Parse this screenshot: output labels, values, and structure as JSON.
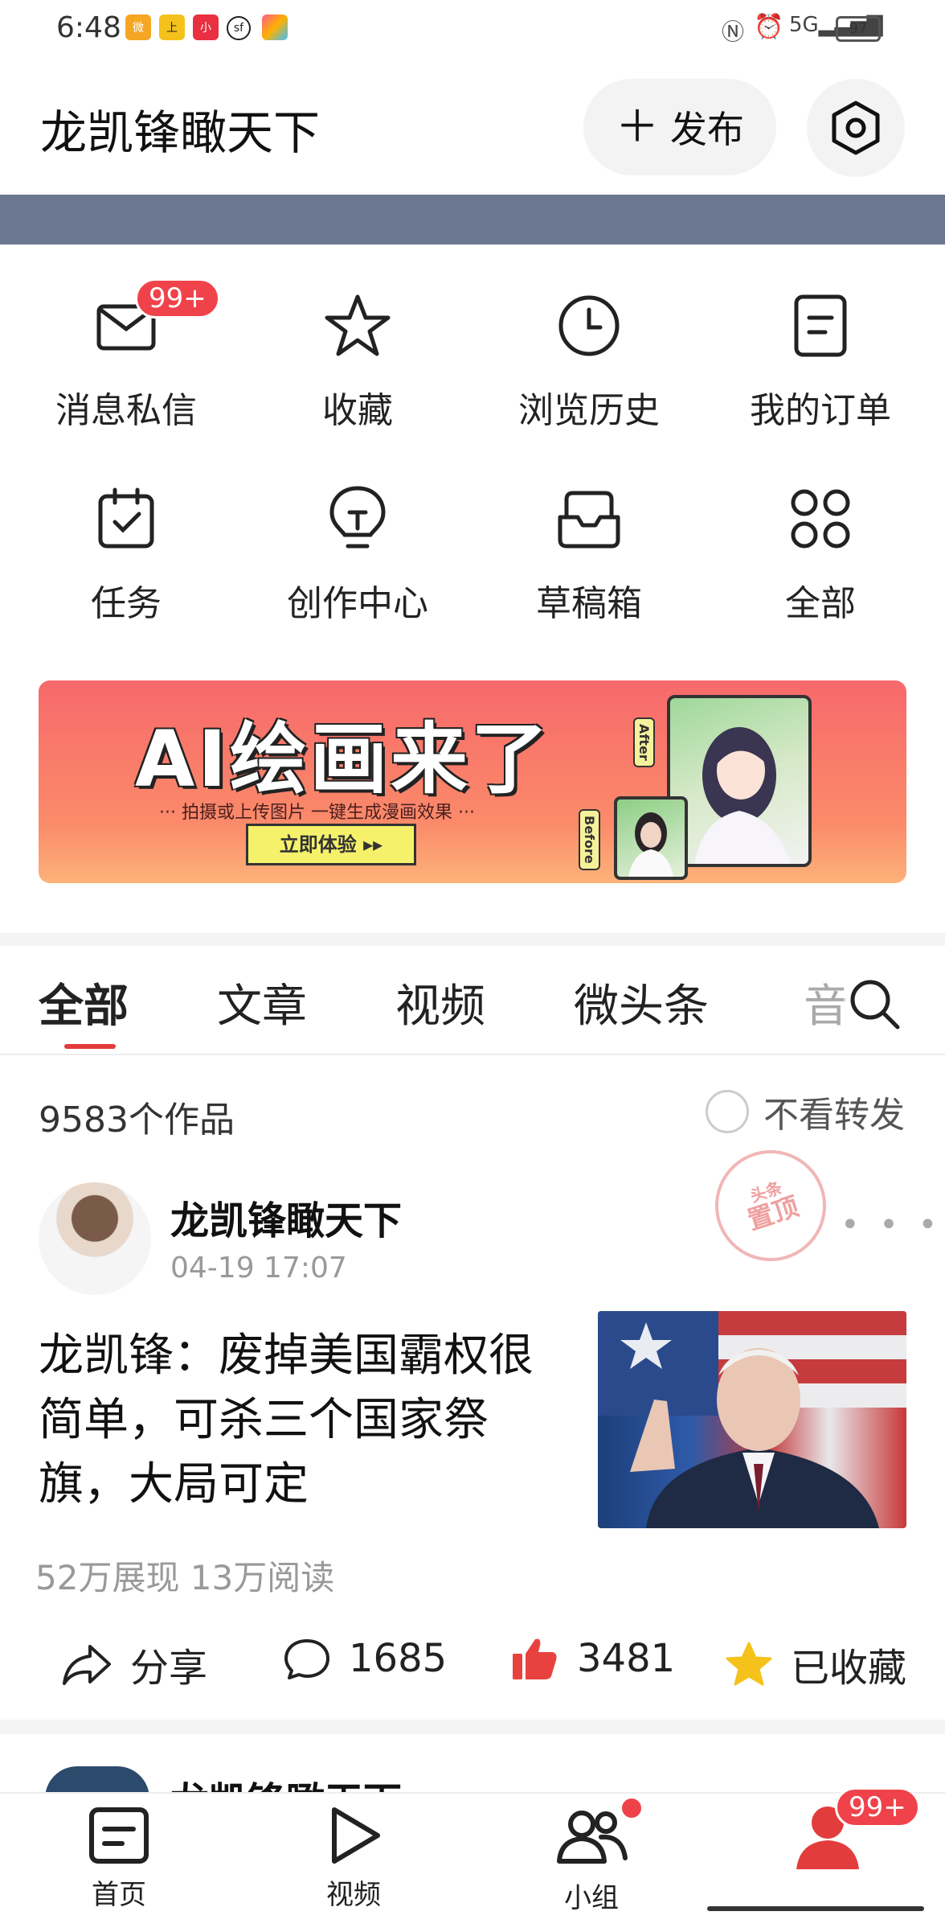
{
  "status_bar": {
    "time": "6:48",
    "battery": "97",
    "app_icons": [
      "weibo-icon",
      "news-icon",
      "xiaohongshu-icon",
      "sf-icon",
      "app-icon"
    ],
    "system_icons": [
      "nfc-icon",
      "alarm-icon",
      "signal-5g-icon"
    ]
  },
  "header": {
    "title": "龙凯锋瞰天下",
    "publish_label": "发布"
  },
  "grid": {
    "items": [
      {
        "label": "消息私信",
        "icon": "mail-icon",
        "badge": "99+"
      },
      {
        "label": "收藏",
        "icon": "star-icon"
      },
      {
        "label": "浏览历史",
        "icon": "clock-icon"
      },
      {
        "label": "我的订单",
        "icon": "order-icon"
      },
      {
        "label": "任务",
        "icon": "calendar-check-icon"
      },
      {
        "label": "创作中心",
        "icon": "lightbulb-icon"
      },
      {
        "label": "草稿箱",
        "icon": "inbox-icon"
      },
      {
        "label": "全部",
        "icon": "grid-icon"
      }
    ]
  },
  "promo": {
    "title": "AI绘画来了",
    "subtitle": "··· 拍摄或上传图片  一键生成漫画效果 ···",
    "button": "立即体验 ▸▸",
    "after_tag": "After",
    "before_tag": "Before"
  },
  "tabs": [
    "全部",
    "文章",
    "视频",
    "微头条",
    "音"
  ],
  "filter": {
    "works_count": "9583个作品",
    "no_repost": "不看转发"
  },
  "post": {
    "author": "龙凯锋瞰天下",
    "date": "04-19 17:07",
    "pinned_seal": "置顶",
    "pinned_seal_top": "头条",
    "headline": "龙凯锋：废掉美国霸权很简单，可杀三个国家祭旗，大局可定",
    "stats": "52万展现  13万阅读",
    "actions": {
      "share": "分享",
      "comments": "1685",
      "likes": "3481",
      "favorited": "已收藏"
    }
  },
  "next_post": {
    "author": "龙凯锋瞰天下"
  },
  "bottom_nav": {
    "items": [
      {
        "label": "首页",
        "icon": "home-doc-icon"
      },
      {
        "label": "视频",
        "icon": "play-icon"
      },
      {
        "label": "小组",
        "icon": "group-icon"
      },
      {
        "label": "",
        "icon": "profile-icon",
        "badge": "99+"
      }
    ]
  },
  "colors": {
    "accent_red": "#e33c3c",
    "badge_red": "#f0424a",
    "like_red": "#e8423f",
    "star_yellow": "#f5c21b"
  }
}
